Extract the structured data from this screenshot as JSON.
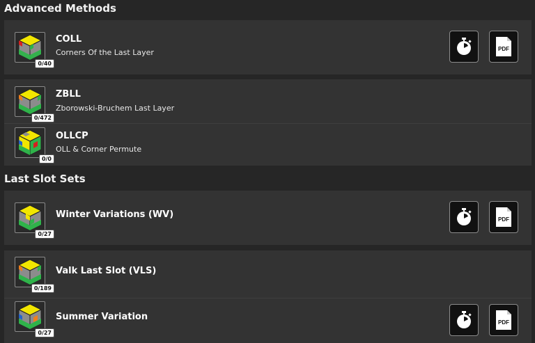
{
  "sections": {
    "advanced": {
      "title": "Advanced Methods"
    },
    "last_slot": {
      "title": "Last Slot Sets"
    }
  },
  "items": {
    "coll": {
      "name": "COLL",
      "desc": "Corners Of the Last Layer",
      "progress": "0/40"
    },
    "zbll": {
      "name": "ZBLL",
      "desc": "Zborowski-Bruchem Last Layer",
      "progress": "0/472"
    },
    "ollcp": {
      "name": "OLLCP",
      "desc": "OLL & Corner Permute",
      "progress": "0/0"
    },
    "wv": {
      "name": "Winter Variations (WV)",
      "progress": "0/27"
    },
    "vls": {
      "name": "Valk Last Slot (VLS)",
      "progress": "0/189"
    },
    "summer": {
      "name": "Summer Variation",
      "progress": "0/27"
    }
  },
  "buttons": {
    "timer_icon": "stopwatch-icon",
    "pdf_label": "PDF"
  },
  "colors": {
    "background": "#262626",
    "card": "#333333",
    "cube_yellow": "#f2e600",
    "cube_green": "#2fb34a",
    "cube_gray": "#8c8c8c",
    "cube_blue": "#2563c9",
    "cube_orange": "#f07f1c",
    "cube_red": "#d62020"
  }
}
